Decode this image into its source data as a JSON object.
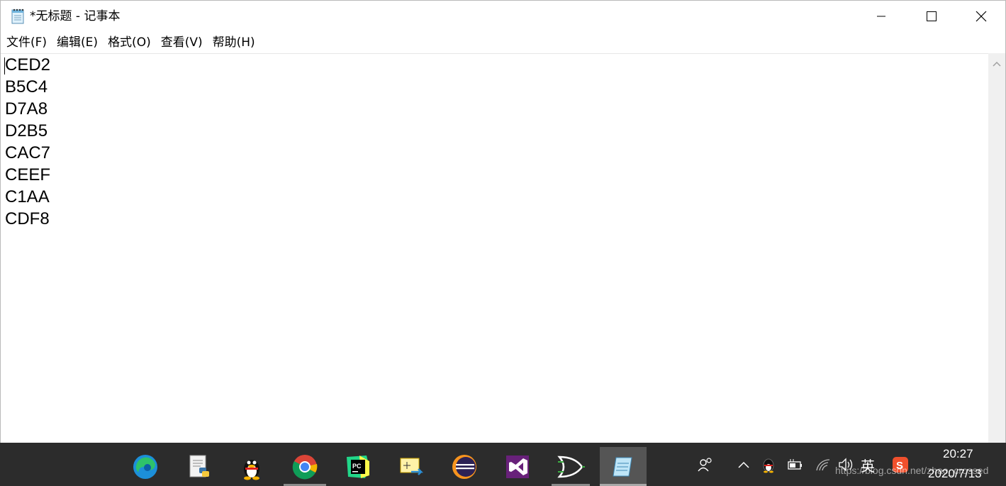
{
  "window": {
    "title": "*无标题 - 记事本",
    "app_icon": "notepad-icon",
    "controls": [
      "minimize-icon",
      "maximize-icon",
      "close-icon"
    ]
  },
  "menu": [
    {
      "label": "文件(F)"
    },
    {
      "label": "编辑(E)"
    },
    {
      "label": "格式(O)"
    },
    {
      "label": "查看(V)"
    },
    {
      "label": "帮助(H)"
    }
  ],
  "editor": {
    "lines": [
      "CED2",
      "B5C4",
      "D7A8",
      "D2B5",
      "CAC7",
      "CEEF",
      "C1AA",
      "CDF8"
    ]
  },
  "taskbar": {
    "apps": [
      {
        "name": "edge-icon"
      },
      {
        "name": "python-idle-icon"
      },
      {
        "name": "qq-icon"
      },
      {
        "name": "chrome-icon"
      },
      {
        "name": "pycharm-icon"
      },
      {
        "name": "snipping-tool-icon"
      },
      {
        "name": "eclipse-icon"
      },
      {
        "name": "visual-studio-icon"
      },
      {
        "name": "logisim-icon"
      },
      {
        "name": "notepad-icon",
        "active": true
      }
    ],
    "tray": {
      "ime_label": "英",
      "time": "20:27",
      "date": "2020/7/13",
      "watermark": "https://blog.csdn.net/zhao_crossed"
    }
  },
  "colors": {
    "taskbar_bg": "#2c2c2c",
    "taskbar_active": "#555555"
  }
}
